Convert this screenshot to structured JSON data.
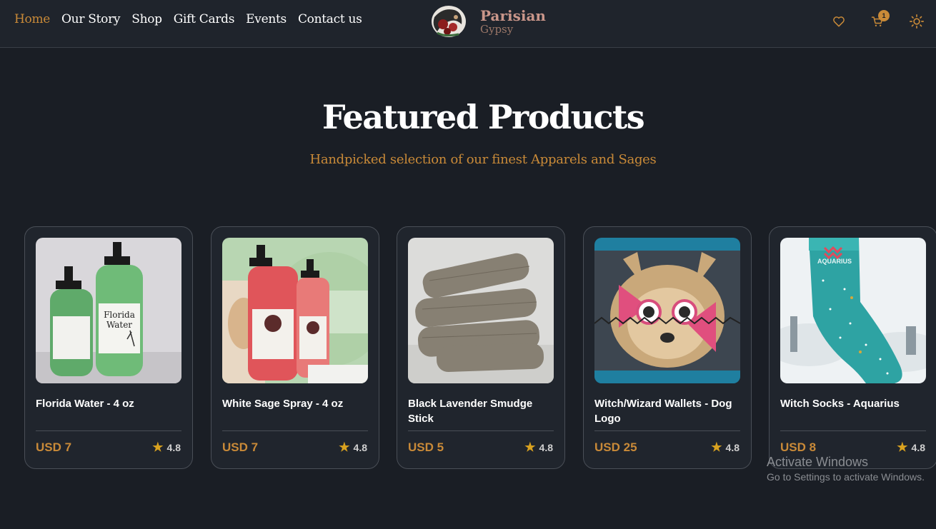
{
  "nav": {
    "items": [
      "Home",
      "Our Story",
      "Shop",
      "Gift Cards",
      "Events",
      "Contact us"
    ],
    "active": "Home"
  },
  "logo": {
    "line1": "Parisian",
    "line2": "Gypsy"
  },
  "header_icons": {
    "wishlist": "heart-icon",
    "cart": "cart-icon",
    "cart_count": "1",
    "theme": "sun-icon"
  },
  "hero": {
    "title": "Featured Products",
    "subtitle": "Handpicked selection of our finest Apparels and Sages"
  },
  "products": [
    {
      "title": "Florida Water - 4 oz",
      "price": "USD 7",
      "rating": "4.8",
      "image": "florida-water-bottles"
    },
    {
      "title": "White Sage Spray - 4 oz",
      "price": "USD 7",
      "rating": "4.8",
      "image": "white-sage-spray-bottles"
    },
    {
      "title": "Black Lavender Smudge Stick",
      "price": "USD 5",
      "rating": "4.8",
      "image": "lavender-smudge-bundles"
    },
    {
      "title": "Witch/Wizard Wallets - Dog Logo",
      "price": "USD 25",
      "rating": "4.8",
      "image": "dog-wallet"
    },
    {
      "title": "Witch Socks - Aquarius",
      "price": "USD 8",
      "rating": "4.8",
      "image": "aquarius-sock"
    }
  ],
  "product_images": {
    "1": {
      "label_lines": [
        "Florida",
        "Water"
      ]
    },
    "3": {
      "banner": "AQUARIUS"
    }
  },
  "watermark": {
    "line1": "Activate Windows",
    "line2": "Go to Settings to activate Windows."
  },
  "colors": {
    "accent": "#c98a38",
    "background": "#1a1e25",
    "card": "#20252d",
    "star": "#d9a21f"
  }
}
